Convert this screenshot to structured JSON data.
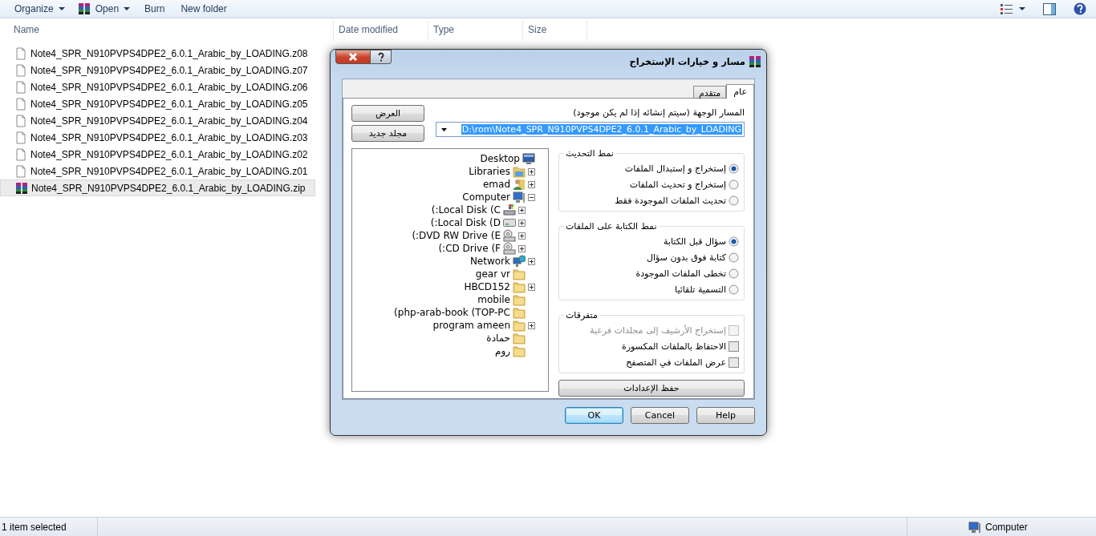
{
  "toolbar": {
    "organize": {
      "label": "Organize",
      "kind": "menu"
    },
    "open": {
      "label": "Open",
      "kind": "archive-menu"
    },
    "burn": {
      "label": "Burn",
      "kind": "plain"
    },
    "new_folder": {
      "label": "New folder",
      "kind": "plain"
    }
  },
  "columns": {
    "name": "Name",
    "date_modified": "Date modified",
    "type": "Type",
    "size": "Size"
  },
  "files": [
    {
      "name": "Note4_SPR_N910PVPS4DPE2_6.0.1_Arabic_by_LOADING.z08",
      "kind": "file",
      "selected": false
    },
    {
      "name": "Note4_SPR_N910PVPS4DPE2_6.0.1_Arabic_by_LOADING.z07",
      "kind": "file",
      "selected": false
    },
    {
      "name": "Note4_SPR_N910PVPS4DPE2_6.0.1_Arabic_by_LOADING.z06",
      "kind": "file",
      "selected": false
    },
    {
      "name": "Note4_SPR_N910PVPS4DPE2_6.0.1_Arabic_by_LOADING.z05",
      "kind": "file",
      "selected": false
    },
    {
      "name": "Note4_SPR_N910PVPS4DPE2_6.0.1_Arabic_by_LOADING.z04",
      "kind": "file",
      "selected": false
    },
    {
      "name": "Note4_SPR_N910PVPS4DPE2_6.0.1_Arabic_by_LOADING.z03",
      "kind": "file",
      "selected": false
    },
    {
      "name": "Note4_SPR_N910PVPS4DPE2_6.0.1_Arabic_by_LOADING.z02",
      "kind": "file",
      "selected": false
    },
    {
      "name": "Note4_SPR_N910PVPS4DPE2_6.0.1_Arabic_by_LOADING.z01",
      "kind": "file",
      "selected": false
    },
    {
      "name": "Note4_SPR_N910PVPS4DPE2_6.0.1_Arabic_by_LOADING.zip",
      "kind": "archive",
      "selected": true
    }
  ],
  "status_bar": {
    "text": "1 item selected",
    "location": "Computer"
  },
  "dialog": {
    "title": "مسار و خيارات الإستخراج",
    "tabs": [
      {
        "label": "عام",
        "selected": true
      },
      {
        "label": "متقدم",
        "selected": false
      }
    ],
    "path_label": "المسار الوجهة (سيتم إنشائه إذا لم يكن موجود)",
    "path_value": "D:\\rom\\Note4_SPR_N910PVPS4DPE2_6.0.1_Arabic_by_LOADING",
    "side_buttons": [
      "العرض",
      "مجلد جديد"
    ],
    "tree": [
      {
        "label": "Desktop",
        "kind": "desktop",
        "children": [
          {
            "label": "Libraries",
            "kind": "libraries",
            "expanded": false
          },
          {
            "label": "emad",
            "kind": "user",
            "expanded": false
          },
          {
            "label": "Computer",
            "kind": "computer",
            "expanded": true,
            "children": [
              {
                "label": "(:Local Disk (C",
                "kind": "system-disk",
                "expanded": false
              },
              {
                "label": "(:Local Disk (D",
                "kind": "disk",
                "expanded": false
              },
              {
                "label": "(:DVD RW Drive (E",
                "kind": "optical",
                "expanded": false
              },
              {
                "label": "(:CD Drive (F",
                "kind": "optical",
                "expanded": false
              }
            ]
          },
          {
            "label": "Network",
            "kind": "network",
            "expanded": false
          },
          {
            "label": "gear vr",
            "kind": "folder"
          },
          {
            "label": "HBCD152",
            "kind": "folder",
            "expanded": false
          },
          {
            "label": "mobile",
            "kind": "folder"
          },
          {
            "label": "(php-arab-book (TOP-PC",
            "kind": "folder"
          },
          {
            "label": "program ameen",
            "kind": "folder",
            "expanded": false
          },
          {
            "label": "حمادة",
            "kind": "folder"
          },
          {
            "label": "روم",
            "kind": "folder"
          }
        ]
      }
    ],
    "groups": [
      {
        "title": "نمط التحديث",
        "kind": "radio",
        "options": [
          {
            "label": "إستخراج و إستبدال الملفات",
            "selected": true
          },
          {
            "label": "إستخراج و تحديث الملفات",
            "selected": false
          },
          {
            "label": "تحديث الملفات الموجودة فقط",
            "selected": false
          }
        ]
      },
      {
        "title": "نمط الكتابة على الملفات",
        "kind": "radio",
        "options": [
          {
            "label": "سؤال قبل الكتابة",
            "selected": true
          },
          {
            "label": "كتابة فوق بدون سؤال",
            "selected": false
          },
          {
            "label": "تخطى الملفات الموجودة",
            "selected": false
          },
          {
            "label": "التسمية تلقائيا",
            "selected": false
          }
        ]
      },
      {
        "title": "متفرقات",
        "kind": "check",
        "options": [
          {
            "label": "إستخراج الأرشيف إلى مجلدات فرعية",
            "checked": false,
            "disabled": true
          },
          {
            "label": "الاحتفاظ بالملفات المكسورة",
            "checked": false,
            "disabled": false
          },
          {
            "label": "عرض الملفات في المتصفح",
            "checked": false,
            "disabled": false
          }
        ]
      }
    ],
    "save_button": "حفظ الإعدادات",
    "buttons": {
      "ok": {
        "label": "OK",
        "default": true
      },
      "cancel": {
        "label": "Cancel",
        "default": false
      },
      "help": {
        "label": "Help",
        "default": false
      }
    }
  }
}
